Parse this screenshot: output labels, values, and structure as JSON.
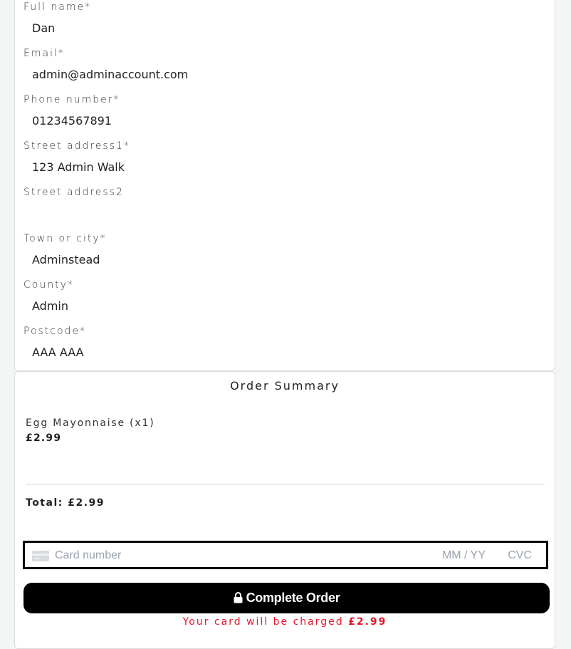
{
  "form": {
    "fields": [
      {
        "label": "Full name*",
        "value": "Dan"
      },
      {
        "label": "Email*",
        "value": "admin@adminaccount.com"
      },
      {
        "label": "Phone number*",
        "value": "01234567891"
      },
      {
        "label": "Street address1*",
        "value": "123 Admin Walk"
      },
      {
        "label": "Street address2",
        "value": ""
      },
      {
        "label": "Town or city*",
        "value": "Adminstead"
      },
      {
        "label": "County*",
        "value": "Admin"
      },
      {
        "label": "Postcode*",
        "value": "AAA AAA"
      }
    ]
  },
  "summary": {
    "title": "Order Summary",
    "item_name": "Egg Mayonnaise (x1)",
    "item_price": "£2.99",
    "total": "Total: £2.99"
  },
  "payment": {
    "card_number_placeholder": "Card number",
    "expiry_placeholder": "MM / YY",
    "cvc_placeholder": "CVC",
    "card_icon": "credit-card-icon",
    "button_label": "Complete Order",
    "button_icon": "lock-icon",
    "charge_text": "Your card will be charged",
    "charge_amount": "£2.99",
    "charge_color": "#e8152d"
  }
}
